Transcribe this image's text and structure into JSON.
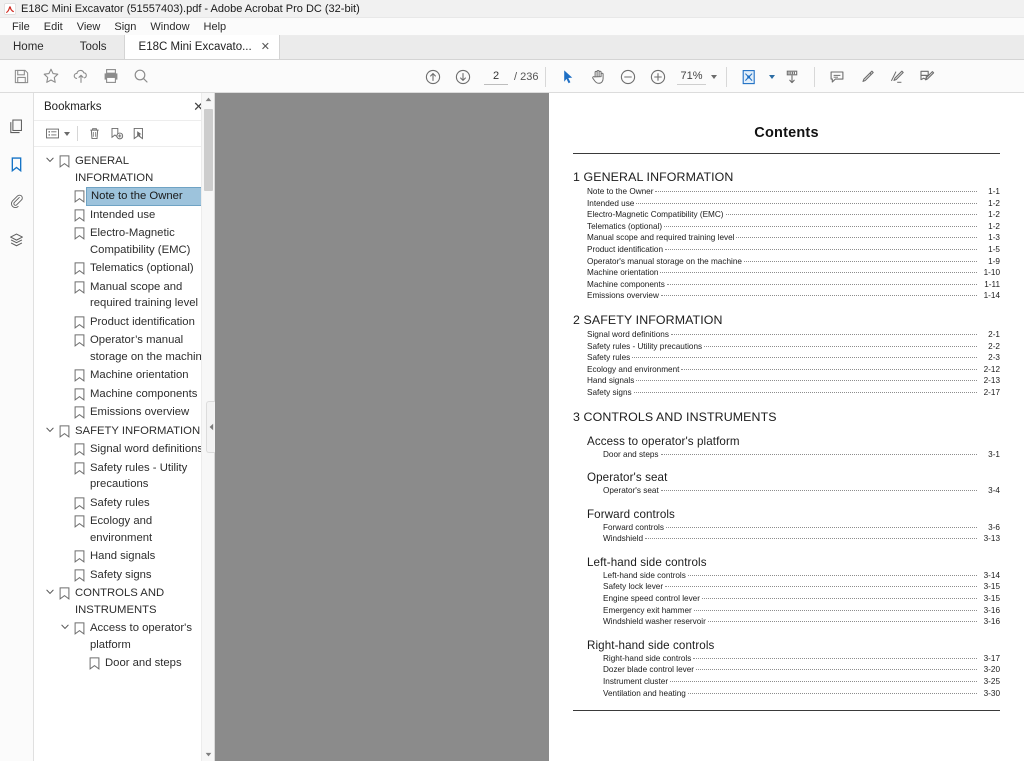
{
  "window": {
    "title": "E18C Mini Excavator (51557403).pdf - Adobe Acrobat Pro DC (32-bit)",
    "app_icon": "acrobat-icon"
  },
  "menubar": {
    "items": [
      "File",
      "Edit",
      "View",
      "Sign",
      "Window",
      "Help"
    ]
  },
  "tabs": {
    "home_label": "Home",
    "tools_label": "Tools",
    "document_label": "E18C Mini Excavato...",
    "close_glyph": "✕"
  },
  "toolbar": {
    "left_icons": [
      "save-icon",
      "star-icon",
      "cloud-upload-icon",
      "print-icon",
      "search-icon"
    ],
    "nav": {
      "prev_page_icon": "arrow-up-circle-icon",
      "next_page_icon": "arrow-down-circle-icon",
      "page_value": "2",
      "page_total": "/ 236"
    },
    "tools": {
      "select_icon": "cursor-arrow-icon",
      "hand_icon": "hand-icon",
      "zoom_out_icon": "zoom-out-icon",
      "zoom_in_icon": "zoom-in-icon",
      "zoom_value": "71%",
      "page_fit_icon": "page-fit-icon",
      "scroll_mode_icon": "scroll-mode-icon"
    },
    "annotate": {
      "comment_icon": "comment-icon",
      "highlight_icon": "highlight-pen-icon",
      "strikethrough_icon": "strikethrough-pen-icon",
      "sign_icon": "sign-document-icon"
    }
  },
  "rail": {
    "items": [
      {
        "name": "page-thumbnails-icon",
        "active": false
      },
      {
        "name": "bookmarks-icon",
        "active": true
      },
      {
        "name": "attachments-icon",
        "active": false
      },
      {
        "name": "layers-icon",
        "active": false
      }
    ]
  },
  "panel": {
    "title": "Bookmarks",
    "close_glyph": "✕",
    "tools": [
      "bookmark-options-icon",
      "delete-bookmark-icon",
      "new-bookmark-icon",
      "bookmark-properties-icon"
    ],
    "bookmarks": [
      {
        "label": "GENERAL INFORMATION",
        "level": 0,
        "expanded": true,
        "selected": false
      },
      {
        "label": "Note to the Owner",
        "level": 1,
        "expanded": null,
        "selected": true
      },
      {
        "label": "Intended use",
        "level": 1,
        "expanded": null,
        "selected": false
      },
      {
        "label": "Electro-Magnetic Compatibility (EMC)",
        "level": 1,
        "expanded": null,
        "selected": false
      },
      {
        "label": "Telematics (optional)",
        "level": 1,
        "expanded": null,
        "selected": false
      },
      {
        "label": "Manual scope and required training level",
        "level": 1,
        "expanded": null,
        "selected": false
      },
      {
        "label": "Product identification",
        "level": 1,
        "expanded": null,
        "selected": false
      },
      {
        "label": "Operator’s manual storage on the machine",
        "level": 1,
        "expanded": null,
        "selected": false
      },
      {
        "label": "Machine orientation",
        "level": 1,
        "expanded": null,
        "selected": false
      },
      {
        "label": "Machine components",
        "level": 1,
        "expanded": null,
        "selected": false
      },
      {
        "label": "Emissions overview",
        "level": 1,
        "expanded": null,
        "selected": false
      },
      {
        "label": "SAFETY INFORMATION",
        "level": 0,
        "expanded": true,
        "selected": false
      },
      {
        "label": "Signal word definitions",
        "level": 1,
        "expanded": null,
        "selected": false
      },
      {
        "label": "Safety rules - Utility precautions",
        "level": 1,
        "expanded": null,
        "selected": false
      },
      {
        "label": "Safety rules",
        "level": 1,
        "expanded": null,
        "selected": false
      },
      {
        "label": "Ecology and environment",
        "level": 1,
        "expanded": null,
        "selected": false
      },
      {
        "label": "Hand signals",
        "level": 1,
        "expanded": null,
        "selected": false
      },
      {
        "label": "Safety signs",
        "level": 1,
        "expanded": null,
        "selected": false
      },
      {
        "label": "CONTROLS AND INSTRUMENTS",
        "level": 0,
        "expanded": true,
        "selected": false
      },
      {
        "label": "Access to operator's platform",
        "level": 1,
        "expanded": true,
        "selected": false
      },
      {
        "label": "Door and steps",
        "level": 2,
        "expanded": null,
        "selected": false
      }
    ],
    "scroll_up_glyph": "∧",
    "scroll_down_glyph": "∨",
    "collapse_glyph": "◀"
  },
  "document": {
    "title": "Contents",
    "blocks": [
      {
        "heading": "1 GENERAL INFORMATION",
        "heading_level": "chapter",
        "entries": [
          {
            "text": "Note to the Owner",
            "page": "1-1"
          },
          {
            "text": "Intended use",
            "page": "1-2"
          },
          {
            "text": "Electro-Magnetic Compatibility (EMC)",
            "page": "1-2"
          },
          {
            "text": "Telematics (optional)",
            "page": "1-2"
          },
          {
            "text": "Manual scope and required training level",
            "page": "1-3"
          },
          {
            "text": "Product identification",
            "page": "1-5"
          },
          {
            "text": "Operator's manual storage on the machine",
            "page": "1-9"
          },
          {
            "text": "Machine orientation",
            "page": "1-10"
          },
          {
            "text": "Machine components",
            "page": "1-11"
          },
          {
            "text": "Emissions overview",
            "page": "1-14"
          }
        ]
      },
      {
        "heading": "2 SAFETY INFORMATION",
        "heading_level": "chapter",
        "entries": [
          {
            "text": "Signal word definitions",
            "page": "2-1"
          },
          {
            "text": "Safety rules - Utility precautions",
            "page": "2-2"
          },
          {
            "text": "Safety rules",
            "page": "2-3"
          },
          {
            "text": "Ecology and environment",
            "page": "2-12"
          },
          {
            "text": "Hand signals",
            "page": "2-13"
          },
          {
            "text": "Safety signs",
            "page": "2-17"
          }
        ]
      },
      {
        "heading": "3 CONTROLS AND INSTRUMENTS",
        "heading_level": "chapter",
        "entries": []
      },
      {
        "heading": "Access to operator's platform",
        "heading_level": "section",
        "entries": [
          {
            "text": "Door and steps",
            "page": "3-1"
          }
        ]
      },
      {
        "heading": "Operator's seat",
        "heading_level": "section",
        "entries": [
          {
            "text": "Operator's seat",
            "page": "3-4"
          }
        ]
      },
      {
        "heading": "Forward controls",
        "heading_level": "section",
        "entries": [
          {
            "text": "Forward controls",
            "page": "3-6"
          },
          {
            "text": "Windshield",
            "page": "3-13"
          }
        ]
      },
      {
        "heading": "Left-hand side controls",
        "heading_level": "section",
        "entries": [
          {
            "text": "Left-hand side controls",
            "page": "3-14"
          },
          {
            "text": "Safety lock lever",
            "page": "3-15"
          },
          {
            "text": "Engine speed control lever",
            "page": "3-15"
          },
          {
            "text": "Emergency exit hammer",
            "page": "3-16"
          },
          {
            "text": "Windshield washer reservoir",
            "page": "3-16"
          }
        ]
      },
      {
        "heading": "Right-hand side controls",
        "heading_level": "section",
        "entries": [
          {
            "text": "Right-hand side controls",
            "page": "3-17"
          },
          {
            "text": "Dozer blade control lever",
            "page": "3-20"
          },
          {
            "text": "Instrument cluster",
            "page": "3-25"
          },
          {
            "text": "Ventilation and heating",
            "page": "3-30"
          }
        ]
      }
    ]
  },
  "colors": {
    "accent_blue": "#1473c6",
    "selection_blue": "#9dc3dc",
    "page_background": "#8b8b8b",
    "chrome_gray": "#fbfbfb"
  }
}
